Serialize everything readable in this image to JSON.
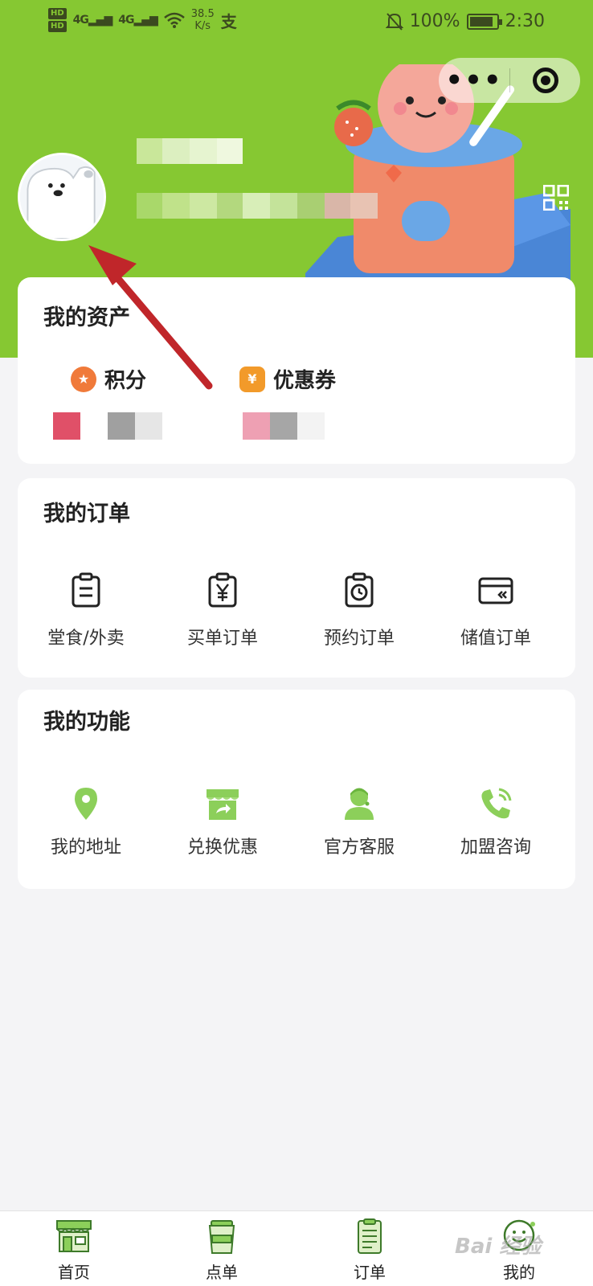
{
  "status_bar": {
    "hd1": "HD",
    "hd2": "HD",
    "sig1": "4G",
    "sig2": "4G",
    "speed_value": "38.5",
    "speed_unit": "K/s",
    "pay_glyph": "支",
    "battery": "100%",
    "time": "2:30",
    "icons": [
      "signal-icon",
      "wifi-icon",
      "alipay-icon",
      "mute-bell-icon",
      "battery-icon"
    ]
  },
  "capsule": {
    "more": "•••",
    "close_icon": "target-close-icon"
  },
  "profile": {
    "avatar_icon": "polar-bear-avatar",
    "qr_icon": "qr-code-icon"
  },
  "assets": {
    "title": "我的资产",
    "points_label": "积分",
    "coupon_label": "优惠券",
    "coupon_icon_text": "¥"
  },
  "orders": {
    "title": "我的订单",
    "items": [
      {
        "label": "堂食/外卖",
        "icon": "clipboard-icon"
      },
      {
        "label": "买单订单",
        "icon": "yen-clipboard-icon"
      },
      {
        "label": "预约订单",
        "icon": "clock-clipboard-icon"
      },
      {
        "label": "储值订单",
        "icon": "wallet-card-icon"
      }
    ]
  },
  "functions": {
    "title": "我的功能",
    "items": [
      {
        "label": "我的地址",
        "icon": "location-pin-icon"
      },
      {
        "label": "兑换优惠",
        "icon": "store-exchange-icon"
      },
      {
        "label": "官方客服",
        "icon": "customer-service-icon"
      },
      {
        "label": "加盟咨询",
        "icon": "phone-call-icon"
      }
    ]
  },
  "bottom_nav": {
    "items": [
      {
        "label": "首页",
        "icon": "storefront-icon"
      },
      {
        "label": "点单",
        "icon": "cup-icon"
      },
      {
        "label": "订单",
        "icon": "receipt-icon"
      },
      {
        "label": "我的",
        "icon": "smiley-icon"
      }
    ]
  },
  "watermark": "Bai 经验",
  "colors": {
    "brand_green": "#86c832",
    "icon_green": "#8ccf5a",
    "arrow_red": "#c0262a"
  }
}
